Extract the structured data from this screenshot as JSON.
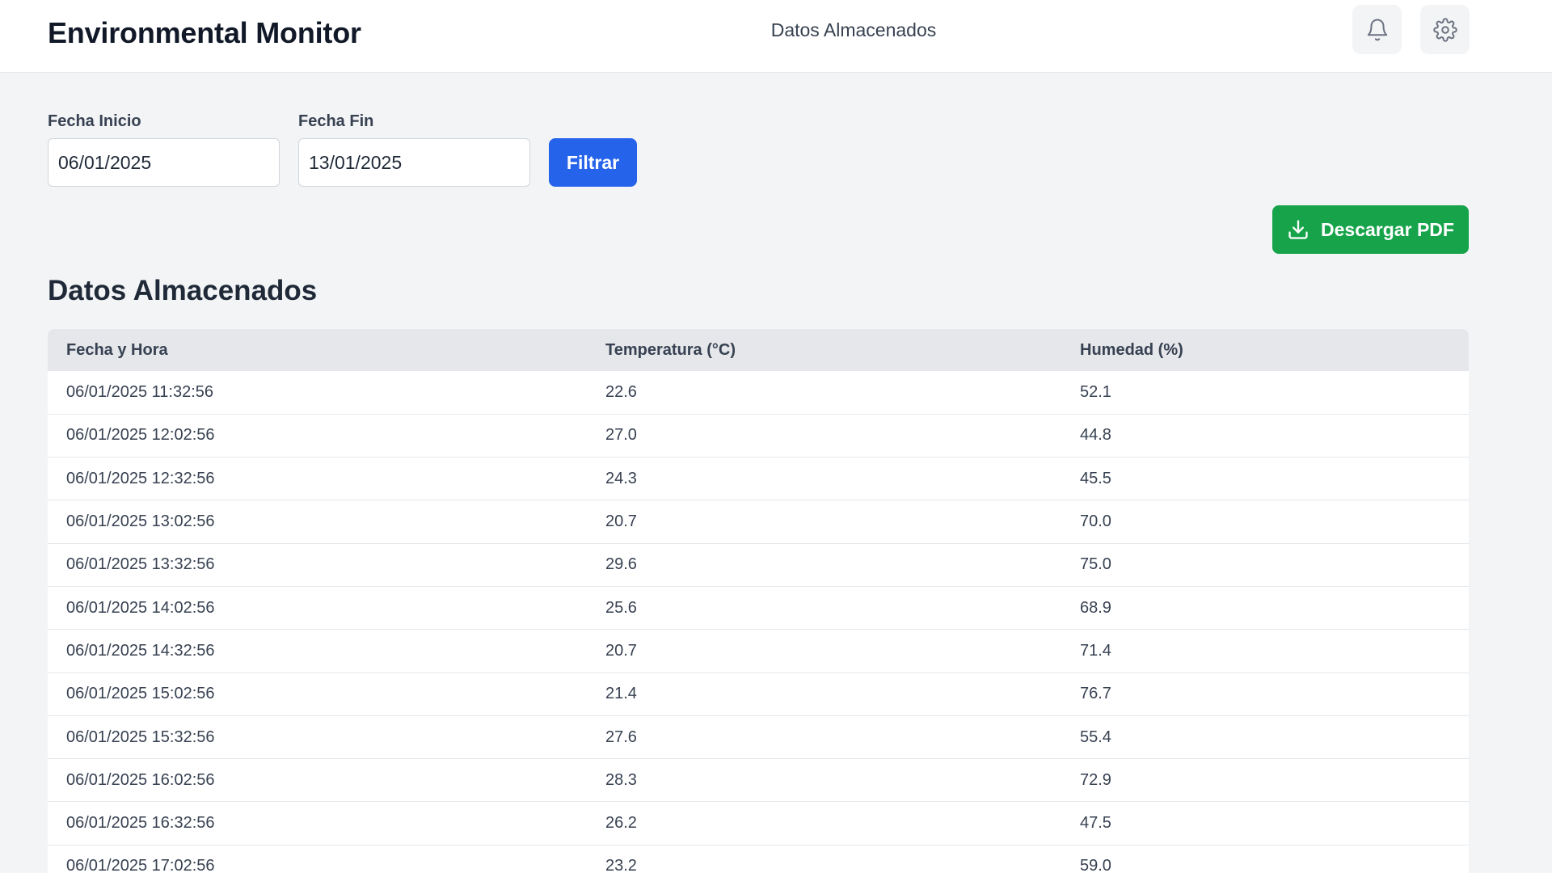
{
  "header": {
    "app_title": "Environmental Monitor",
    "nav_link": "Datos Almacenados",
    "icons": [
      "bell-icon",
      "gear-icon"
    ]
  },
  "filters": {
    "start_label": "Fecha Inicio",
    "start_value": "06/01/2025",
    "end_label": "Fecha Fin",
    "end_value": "13/01/2025",
    "filter_button": "Filtrar"
  },
  "download_button": {
    "label": "Descargar PDF",
    "icon": "download-icon"
  },
  "section_title": "Datos Almacenados",
  "table": {
    "columns": [
      "Fecha y Hora",
      "Temperatura (°C)",
      "Humedad (%)"
    ],
    "rows": [
      [
        "06/01/2025 11:32:56",
        "22.6",
        "52.1"
      ],
      [
        "06/01/2025 12:02:56",
        "27.0",
        "44.8"
      ],
      [
        "06/01/2025 12:32:56",
        "24.3",
        "45.5"
      ],
      [
        "06/01/2025 13:02:56",
        "20.7",
        "70.0"
      ],
      [
        "06/01/2025 13:32:56",
        "29.6",
        "75.0"
      ],
      [
        "06/01/2025 14:02:56",
        "25.6",
        "68.9"
      ],
      [
        "06/01/2025 14:32:56",
        "20.7",
        "71.4"
      ],
      [
        "06/01/2025 15:02:56",
        "21.4",
        "76.7"
      ],
      [
        "06/01/2025 15:32:56",
        "27.6",
        "55.4"
      ],
      [
        "06/01/2025 16:02:56",
        "28.3",
        "72.9"
      ],
      [
        "06/01/2025 16:32:56",
        "26.2",
        "47.5"
      ],
      [
        "06/01/2025 17:02:56",
        "23.2",
        "59.0"
      ]
    ]
  },
  "colors": {
    "primary": "#2563eb",
    "success": "#16a34a",
    "background": "#f3f4f6",
    "table_header": "#e5e7eb"
  }
}
